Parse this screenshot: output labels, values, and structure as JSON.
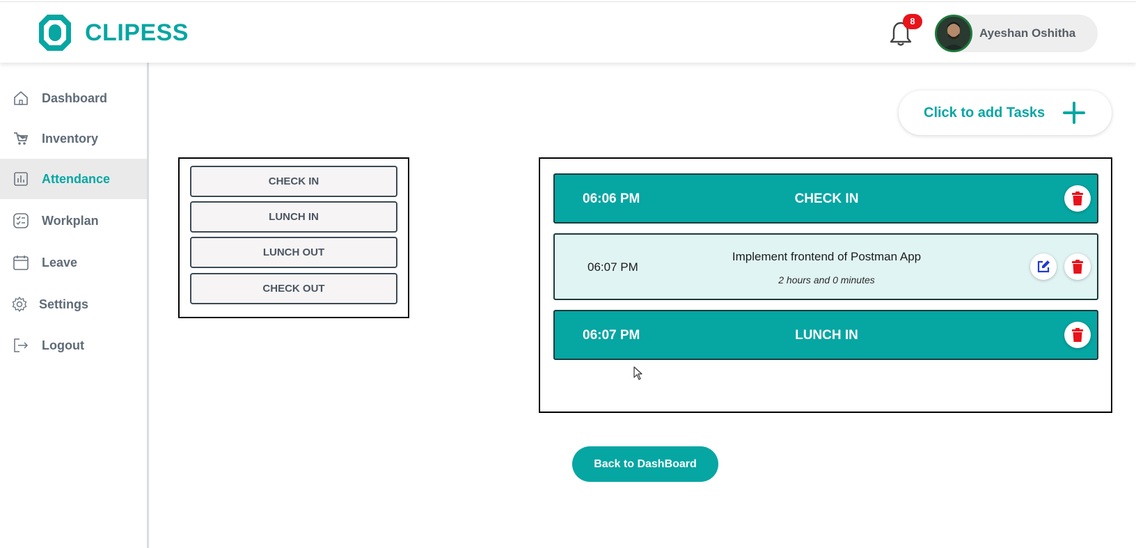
{
  "brand": {
    "name": "CLIPESS",
    "color": "#06a6a3"
  },
  "header": {
    "notification_count": "8",
    "user_name": "Ayeshan Oshitha"
  },
  "sidebar": {
    "items": [
      {
        "label": "Dashboard",
        "icon": "home-icon"
      },
      {
        "label": "Inventory",
        "icon": "cart-icon"
      },
      {
        "label": "Attendance",
        "icon": "chart-icon",
        "active": true
      },
      {
        "label": "Workplan",
        "icon": "checklist-icon"
      },
      {
        "label": "Leave",
        "icon": "calendar-icon"
      },
      {
        "label": "Settings",
        "icon": "gear-icon"
      },
      {
        "label": "Logout",
        "icon": "logout-icon"
      }
    ]
  },
  "add_task": {
    "label": "Click to add Tasks"
  },
  "actions": {
    "check_in": "CHECK IN",
    "lunch_in": "LUNCH IN",
    "lunch_out": "LUNCH OUT",
    "check_out": "CHECK OUT"
  },
  "timeline": {
    "entries": [
      {
        "time": "06:06 PM",
        "title": "CHECK IN"
      },
      {
        "time": "06:07 PM",
        "title": "Implement frontend of Postman App",
        "duration": "2 hours and 0 minutes"
      },
      {
        "time": "06:07 PM",
        "title": "LUNCH IN"
      }
    ]
  },
  "back_button": {
    "label": "Back to DashBoard"
  },
  "colors": {
    "accent": "#06a6a3",
    "danger": "#e8131b",
    "edit": "#1e3bd6"
  }
}
